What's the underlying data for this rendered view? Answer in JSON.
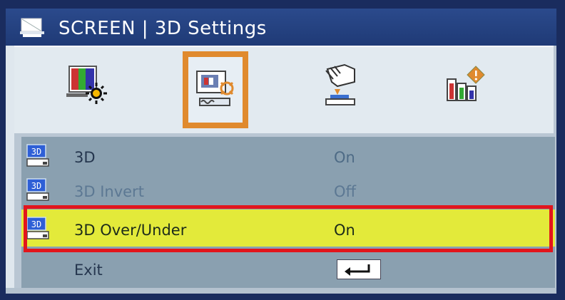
{
  "window": {
    "title": "SCREEN | 3D Settings",
    "title_icon": "screen-icon"
  },
  "tabs": [
    {
      "name": "picture-tab",
      "icon": "picture-color-icon",
      "active": false
    },
    {
      "name": "screen-tab",
      "icon": "screen-settings-icon",
      "active": true
    },
    {
      "name": "setting-tab",
      "icon": "hand-setting-icon",
      "active": false
    },
    {
      "name": "options-tab",
      "icon": "info-chart-icon",
      "active": false
    }
  ],
  "menu": {
    "items": [
      {
        "label": "3D",
        "value": "On",
        "icon": "3d-icon"
      },
      {
        "label": "3D Invert",
        "value": "Off",
        "icon": "3d-icon"
      },
      {
        "label": "3D Over/Under",
        "value": "On",
        "icon": "3d-icon",
        "selected": true
      },
      {
        "label": "Exit",
        "value_icon": "enter-icon"
      }
    ]
  },
  "colors": {
    "title_bar": "#1f3a76",
    "selection": "#e3ea3a",
    "highlight_border": "#e2151c",
    "active_tab_border": "#e08a2e"
  }
}
